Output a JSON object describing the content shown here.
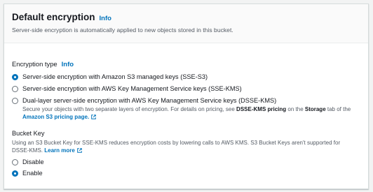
{
  "header": {
    "title": "Default encryption",
    "info": "Info",
    "description": "Server-side encryption is automatically applied to new objects stored in this bucket."
  },
  "encryption_type": {
    "label": "Encryption type",
    "info": "Info",
    "options": [
      {
        "label": "Server-side encryption with Amazon S3 managed keys (SSE-S3)",
        "checked": true
      },
      {
        "label": "Server-side encryption with AWS Key Management Service keys (SSE-KMS)",
        "checked": false
      },
      {
        "label": "Dual-layer server-side encryption with AWS Key Management Service keys (DSSE-KMS)",
        "checked": false,
        "desc_prefix": "Secure your objects with two separate layers of encryption. For details on pricing, see ",
        "desc_bold_1": "DSSE-KMS pricing",
        "desc_mid": " on the ",
        "desc_bold_2": "Storage",
        "desc_suffix": " tab of the ",
        "desc_link": "Amazon S3 pricing page."
      }
    ]
  },
  "bucket_key": {
    "title": "Bucket Key",
    "description": "Using an S3 Bucket Key for SSE-KMS reduces encryption costs by lowering calls to AWS KMS. S3 Bucket Keys aren't supported for DSSE-KMS. ",
    "learn_more": "Learn more",
    "options": [
      {
        "label": "Disable",
        "checked": false
      },
      {
        "label": "Enable",
        "checked": true
      }
    ]
  },
  "colors": {
    "accent": "#0073bb",
    "text": "#16191f",
    "secondary_text": "#545b64",
    "border": "#d5dbdb"
  },
  "icons": {
    "external_link": "external-link-icon"
  }
}
